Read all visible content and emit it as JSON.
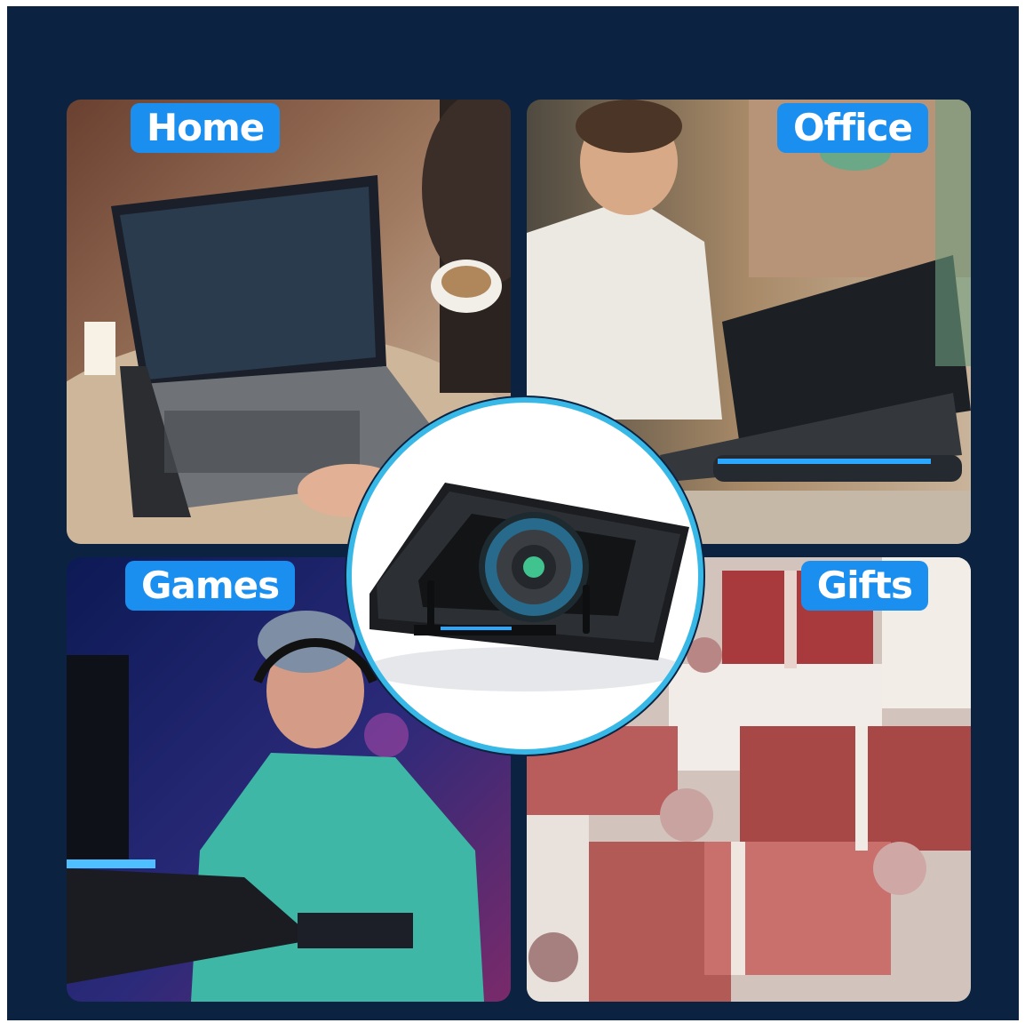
{
  "scenes": {
    "home": {
      "label": "Home"
    },
    "office": {
      "label": "Office"
    },
    "games": {
      "label": "Games"
    },
    "gifts": {
      "label": "Gifts"
    }
  },
  "product": {
    "name": "laptop-cooling-stand",
    "accent": "#38b8e6"
  },
  "colors": {
    "background": "#0b2240",
    "tag": "#1a8ff0",
    "tag_text": "#ffffff"
  }
}
